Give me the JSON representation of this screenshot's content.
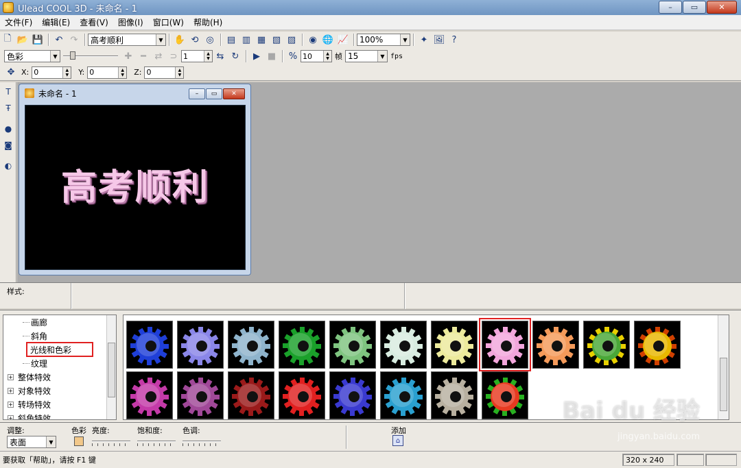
{
  "window": {
    "title": "Ulead COOL 3D - 未命名 - 1",
    "minimize": "–",
    "maximize": "▭",
    "close": "✕"
  },
  "menu": [
    "文件(F)",
    "编辑(E)",
    "查看(V)",
    "图像(I)",
    "窗口(W)",
    "帮助(H)"
  ],
  "toolbar1": {
    "text_combo": "高考顺利",
    "zoom_combo": "100%"
  },
  "toolbar2": {
    "mode_combo": "色彩",
    "frame_value": "1",
    "frames_value": "10",
    "frames_label": "帧",
    "fps_value": "15",
    "fps_label": "fps"
  },
  "toolbar3": {
    "x_label": "X:",
    "x_value": "0",
    "y_label": "Y:",
    "y_value": "0",
    "z_label": "Z:",
    "z_value": "0"
  },
  "document": {
    "title": "未命名 - 1",
    "canvas_text": "高考顺利"
  },
  "stylebar": {
    "label": "样式:"
  },
  "library": {
    "tree": [
      {
        "label": "画廊",
        "kind": "child"
      },
      {
        "label": "斜角",
        "kind": "child"
      },
      {
        "label": "光线和色彩",
        "kind": "child",
        "highlight": true
      },
      {
        "label": "纹理",
        "kind": "child"
      },
      {
        "label": "整体特效",
        "kind": "parent"
      },
      {
        "label": "对象特效",
        "kind": "parent"
      },
      {
        "label": "转场特效",
        "kind": "parent"
      },
      {
        "label": "斜角特效",
        "kind": "parent"
      }
    ],
    "presets": [
      {
        "color": "#1f3fd8"
      },
      {
        "color": "#8a86e8"
      },
      {
        "color": "#8fb4cc"
      },
      {
        "color": "#1aa02a"
      },
      {
        "color": "#7fc480"
      },
      {
        "color": "#d8ece0"
      },
      {
        "color": "#ecea9c"
      },
      {
        "color": "#f2a6dc",
        "selected": true
      },
      {
        "color": "#f49a5a"
      },
      {
        "color": "#4aa838",
        "accent": "#e8d000"
      },
      {
        "color": "#e8b800",
        "accent": "#d04000"
      },
      {
        "color": "#c43aa8"
      },
      {
        "color": "#a04898"
      },
      {
        "color": "#9a1a1a"
      },
      {
        "color": "#e02020"
      },
      {
        "color": "#3a3ad0"
      },
      {
        "color": "#2aa0d0"
      },
      {
        "color": "#b8b0a0"
      },
      {
        "color": "#e83a20",
        "accent": "#28b020"
      }
    ]
  },
  "attributes": {
    "adjust_label": "调整:",
    "adjust_value": "表面",
    "color_label": "色彩",
    "brightness_label": "亮度:",
    "saturation_label": "饱和度:",
    "hue_label": "色调:",
    "add_label": "添加"
  },
  "status": {
    "hint": "要获取「帮助」，请按 F1 键",
    "size": "320 x 240"
  },
  "watermark": {
    "brand": "Bai du 经验",
    "site": "jingyan.baidu.com"
  }
}
